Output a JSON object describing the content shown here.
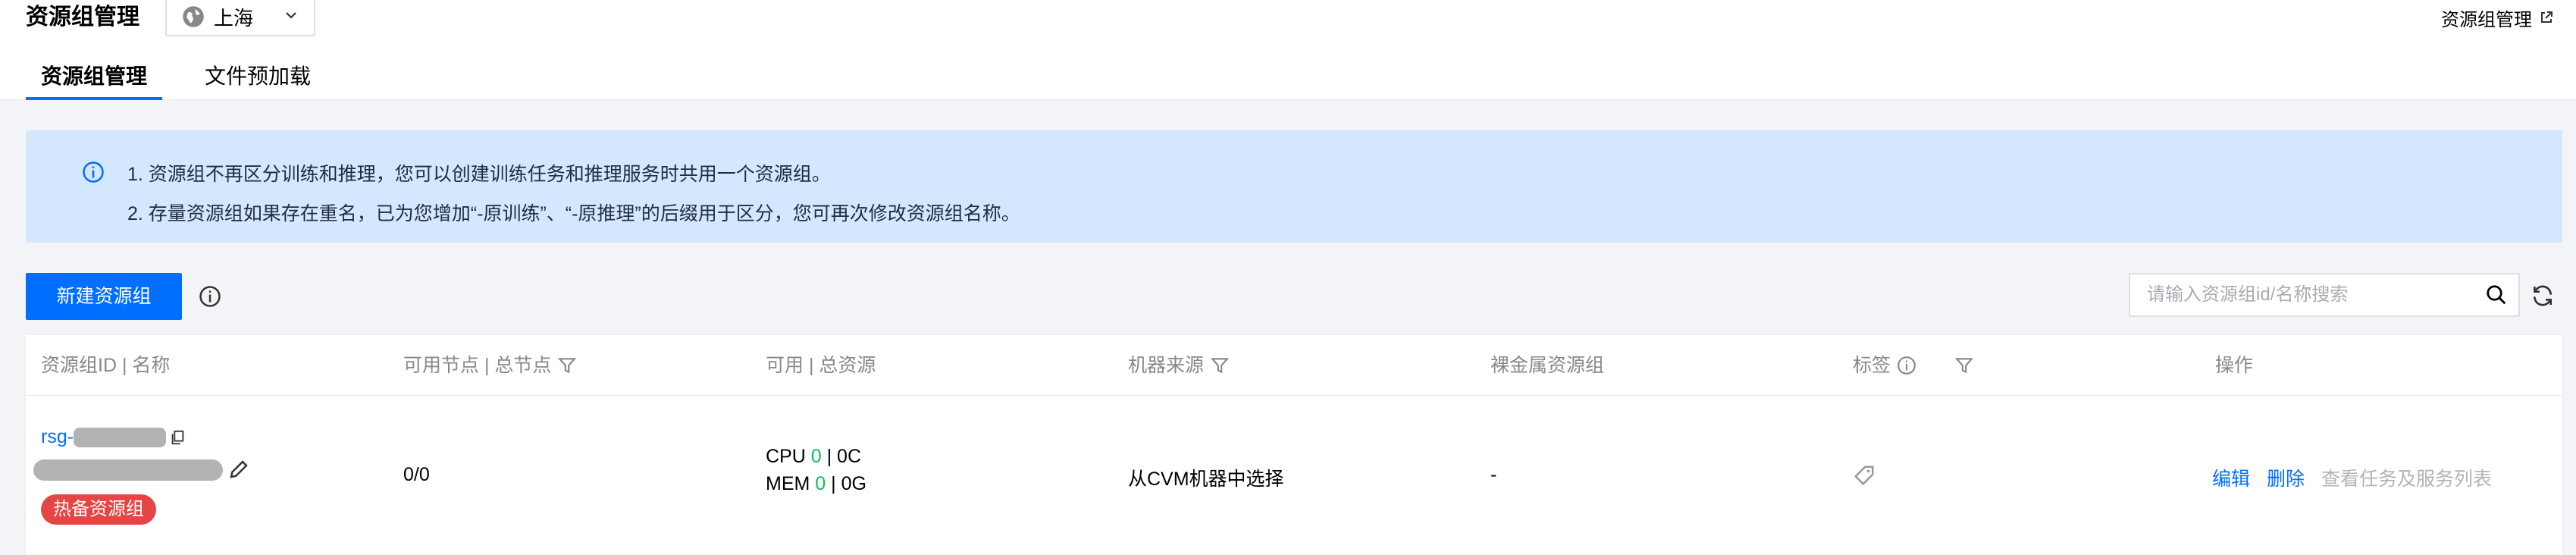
{
  "header": {
    "title": "资源组管理",
    "region": "上海",
    "top_right_link": "资源组管理"
  },
  "tabs": [
    {
      "label": "资源组管理",
      "active": true
    },
    {
      "label": "文件预加载",
      "active": false
    }
  ],
  "notice": {
    "lines": [
      "1. 资源组不再区分训练和推理，您可以创建训练任务和推理服务时共用一个资源组。",
      "2. 存量资源组如果存在重名，已为您增加“-原训练”、“-原推理”的后缀用于区分，您可再次修改资源组名称。"
    ]
  },
  "toolbar": {
    "new_button": "新建资源组",
    "search_placeholder": "请输入资源组id/名称搜索"
  },
  "table": {
    "columns": [
      "资源组ID | 名称",
      "可用节点 | 总节点",
      "可用 | 总资源",
      "机器来源",
      "裸金属资源组",
      "标签",
      "操作"
    ],
    "rows": [
      {
        "id_prefix": "rsg-",
        "badge": "热备资源组",
        "nodes": "0/0",
        "cpu_label": "CPU",
        "cpu_avail": "0",
        "cpu_total": "| 0C",
        "mem_label": "MEM",
        "mem_avail": "0",
        "mem_total": "| 0G",
        "source": "从CVM机器中选择",
        "bare_metal": "-",
        "actions": {
          "edit": "编辑",
          "delete": "删除",
          "view": "查看任务及服务列表"
        }
      }
    ]
  },
  "colors": {
    "primary": "#006eff",
    "notice_bg": "#d5e7ff",
    "badge_red": "#e54545",
    "available_green": "#0abf5b"
  }
}
